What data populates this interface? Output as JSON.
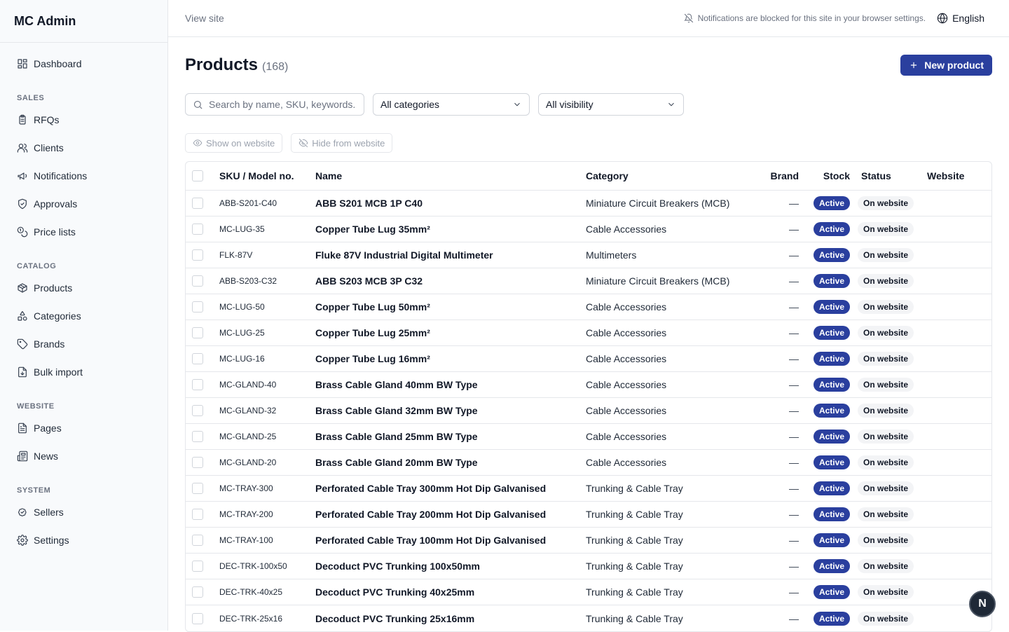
{
  "app": {
    "title": "MC Admin"
  },
  "sidebar": {
    "items": [
      {
        "label": "Dashboard",
        "icon": "dashboard-icon"
      },
      {
        "section": "SALES"
      },
      {
        "label": "RFQs",
        "icon": "clipboard-icon"
      },
      {
        "label": "Clients",
        "icon": "users-icon"
      },
      {
        "label": "Notifications",
        "icon": "megaphone-icon"
      },
      {
        "label": "Approvals",
        "icon": "shield-check-icon"
      },
      {
        "label": "Price lists",
        "icon": "coins-icon"
      },
      {
        "section": "CATALOG"
      },
      {
        "label": "Products",
        "icon": "package-icon"
      },
      {
        "label": "Categories",
        "icon": "shapes-icon"
      },
      {
        "label": "Brands",
        "icon": "tag-icon"
      },
      {
        "label": "Bulk import",
        "icon": "file-import-icon"
      },
      {
        "section": "WEBSITE"
      },
      {
        "label": "Pages",
        "icon": "file-text-icon"
      },
      {
        "label": "News",
        "icon": "newspaper-icon"
      },
      {
        "section": "SYSTEM"
      },
      {
        "label": "Sellers",
        "icon": "badge-check-icon"
      },
      {
        "label": "Settings",
        "icon": "gear-icon"
      }
    ]
  },
  "topbar": {
    "view_site": "View site",
    "notifications_blocked": "Notifications are blocked for this site in your browser settings.",
    "language": "English"
  },
  "page": {
    "title": "Products",
    "count": "(168)",
    "new_button": "New product"
  },
  "filters": {
    "search_placeholder": "Search by name, SKU, keywords...",
    "category": "All categories",
    "visibility": "All visibility"
  },
  "bulk": {
    "show": "Show on website",
    "hide": "Hide from website"
  },
  "table": {
    "columns": [
      "SKU / Model no.",
      "Name",
      "Category",
      "Brand",
      "Stock",
      "Status",
      "Website"
    ],
    "rows": [
      {
        "sku": "ABB-S201-C40",
        "name": "ABB S201 MCB 1P C40",
        "category": "Miniature Circuit Breakers (MCB)",
        "brand": "—",
        "stock": "Active",
        "status": "On website"
      },
      {
        "sku": "MC-LUG-35",
        "name": "Copper Tube Lug 35mm²",
        "category": "Cable Accessories",
        "brand": "—",
        "stock": "Active",
        "status": "On website"
      },
      {
        "sku": "FLK-87V",
        "name": "Fluke 87V Industrial Digital Multimeter",
        "category": "Multimeters",
        "brand": "—",
        "stock": "Active",
        "status": "On website"
      },
      {
        "sku": "ABB-S203-C32",
        "name": "ABB S203 MCB 3P C32",
        "category": "Miniature Circuit Breakers (MCB)",
        "brand": "—",
        "stock": "Active",
        "status": "On website"
      },
      {
        "sku": "MC-LUG-50",
        "name": "Copper Tube Lug 50mm²",
        "category": "Cable Accessories",
        "brand": "—",
        "stock": "Active",
        "status": "On website"
      },
      {
        "sku": "MC-LUG-25",
        "name": "Copper Tube Lug 25mm²",
        "category": "Cable Accessories",
        "brand": "—",
        "stock": "Active",
        "status": "On website"
      },
      {
        "sku": "MC-LUG-16",
        "name": "Copper Tube Lug 16mm²",
        "category": "Cable Accessories",
        "brand": "—",
        "stock": "Active",
        "status": "On website"
      },
      {
        "sku": "MC-GLAND-40",
        "name": "Brass Cable Gland 40mm BW Type",
        "category": "Cable Accessories",
        "brand": "—",
        "stock": "Active",
        "status": "On website"
      },
      {
        "sku": "MC-GLAND-32",
        "name": "Brass Cable Gland 32mm BW Type",
        "category": "Cable Accessories",
        "brand": "—",
        "stock": "Active",
        "status": "On website"
      },
      {
        "sku": "MC-GLAND-25",
        "name": "Brass Cable Gland 25mm BW Type",
        "category": "Cable Accessories",
        "brand": "—",
        "stock": "Active",
        "status": "On website"
      },
      {
        "sku": "MC-GLAND-20",
        "name": "Brass Cable Gland 20mm BW Type",
        "category": "Cable Accessories",
        "brand": "—",
        "stock": "Active",
        "status": "On website"
      },
      {
        "sku": "MC-TRAY-300",
        "name": "Perforated Cable Tray 300mm Hot Dip Galvanised",
        "category": "Trunking & Cable Tray",
        "brand": "—",
        "stock": "Active",
        "status": "On website"
      },
      {
        "sku": "MC-TRAY-200",
        "name": "Perforated Cable Tray 200mm Hot Dip Galvanised",
        "category": "Trunking & Cable Tray",
        "brand": "—",
        "stock": "Active",
        "status": "On website"
      },
      {
        "sku": "MC-TRAY-100",
        "name": "Perforated Cable Tray 100mm Hot Dip Galvanised",
        "category": "Trunking & Cable Tray",
        "brand": "—",
        "stock": "Active",
        "status": "On website"
      },
      {
        "sku": "DEC-TRK-100x50",
        "name": "Decoduct PVC Trunking 100x50mm",
        "category": "Trunking & Cable Tray",
        "brand": "—",
        "stock": "Active",
        "status": "On website"
      },
      {
        "sku": "DEC-TRK-40x25",
        "name": "Decoduct PVC Trunking 40x25mm",
        "category": "Trunking & Cable Tray",
        "brand": "—",
        "stock": "Active",
        "status": "On website"
      },
      {
        "sku": "DEC-TRK-25x16",
        "name": "Decoduct PVC Trunking 25x16mm",
        "category": "Trunking & Cable Tray",
        "brand": "—",
        "stock": "Active",
        "status": "On website"
      }
    ]
  },
  "fab": {
    "label": "N"
  },
  "colors": {
    "accent": "#2a3f9e",
    "border": "#e5e7eb",
    "sidebar_bg": "#f8fafc"
  }
}
